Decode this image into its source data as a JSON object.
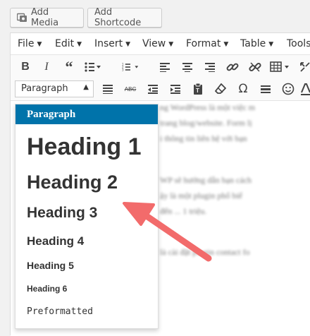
{
  "top_buttons": {
    "add_media": "Add Media",
    "add_shortcode": "Add Shortcode"
  },
  "menubar": [
    "File",
    "Edit",
    "Insert",
    "View",
    "Format",
    "Table",
    "Tools"
  ],
  "format_select": {
    "value": "Paragraph"
  },
  "format_dropdown": {
    "items": [
      "Paragraph",
      "Heading 1",
      "Heading 2",
      "Heading 3",
      "Heading 4",
      "Heading 5",
      "Heading 6",
      "Preformatted"
    ],
    "selected": "Paragraph",
    "accent": "#0073aa"
  },
  "toolbar_icons": [
    "bold-icon",
    "italic-icon",
    "blockquote-icon",
    "bulleted-list-icon",
    "numbered-list-icon",
    "align-left-icon",
    "align-center-icon",
    "align-right-icon",
    "link-icon",
    "unlink-icon",
    "table-icon",
    "fullscreen-icon",
    "align-justify-icon",
    "strikethrough-icon",
    "outdent-icon",
    "indent-icon",
    "paste-as-text-icon",
    "clear-formatting-icon",
    "special-character-icon",
    "horizontal-line-icon",
    "emoticons-icon",
    "text-color-icon"
  ],
  "annotation": {
    "color": "#f26b6b"
  },
  "content_lines": [
    "ng WordPress là một việc m",
    "trang blog/website. Form lị",
    "i thông tin liên hệ với bạn",
    "WP sẽ hướng dẫn bạn cách",
    "ậy là một plugin phổ biế",
    "đến ... 1 triệu.",
    "là cài đặt plugin contact fo"
  ]
}
